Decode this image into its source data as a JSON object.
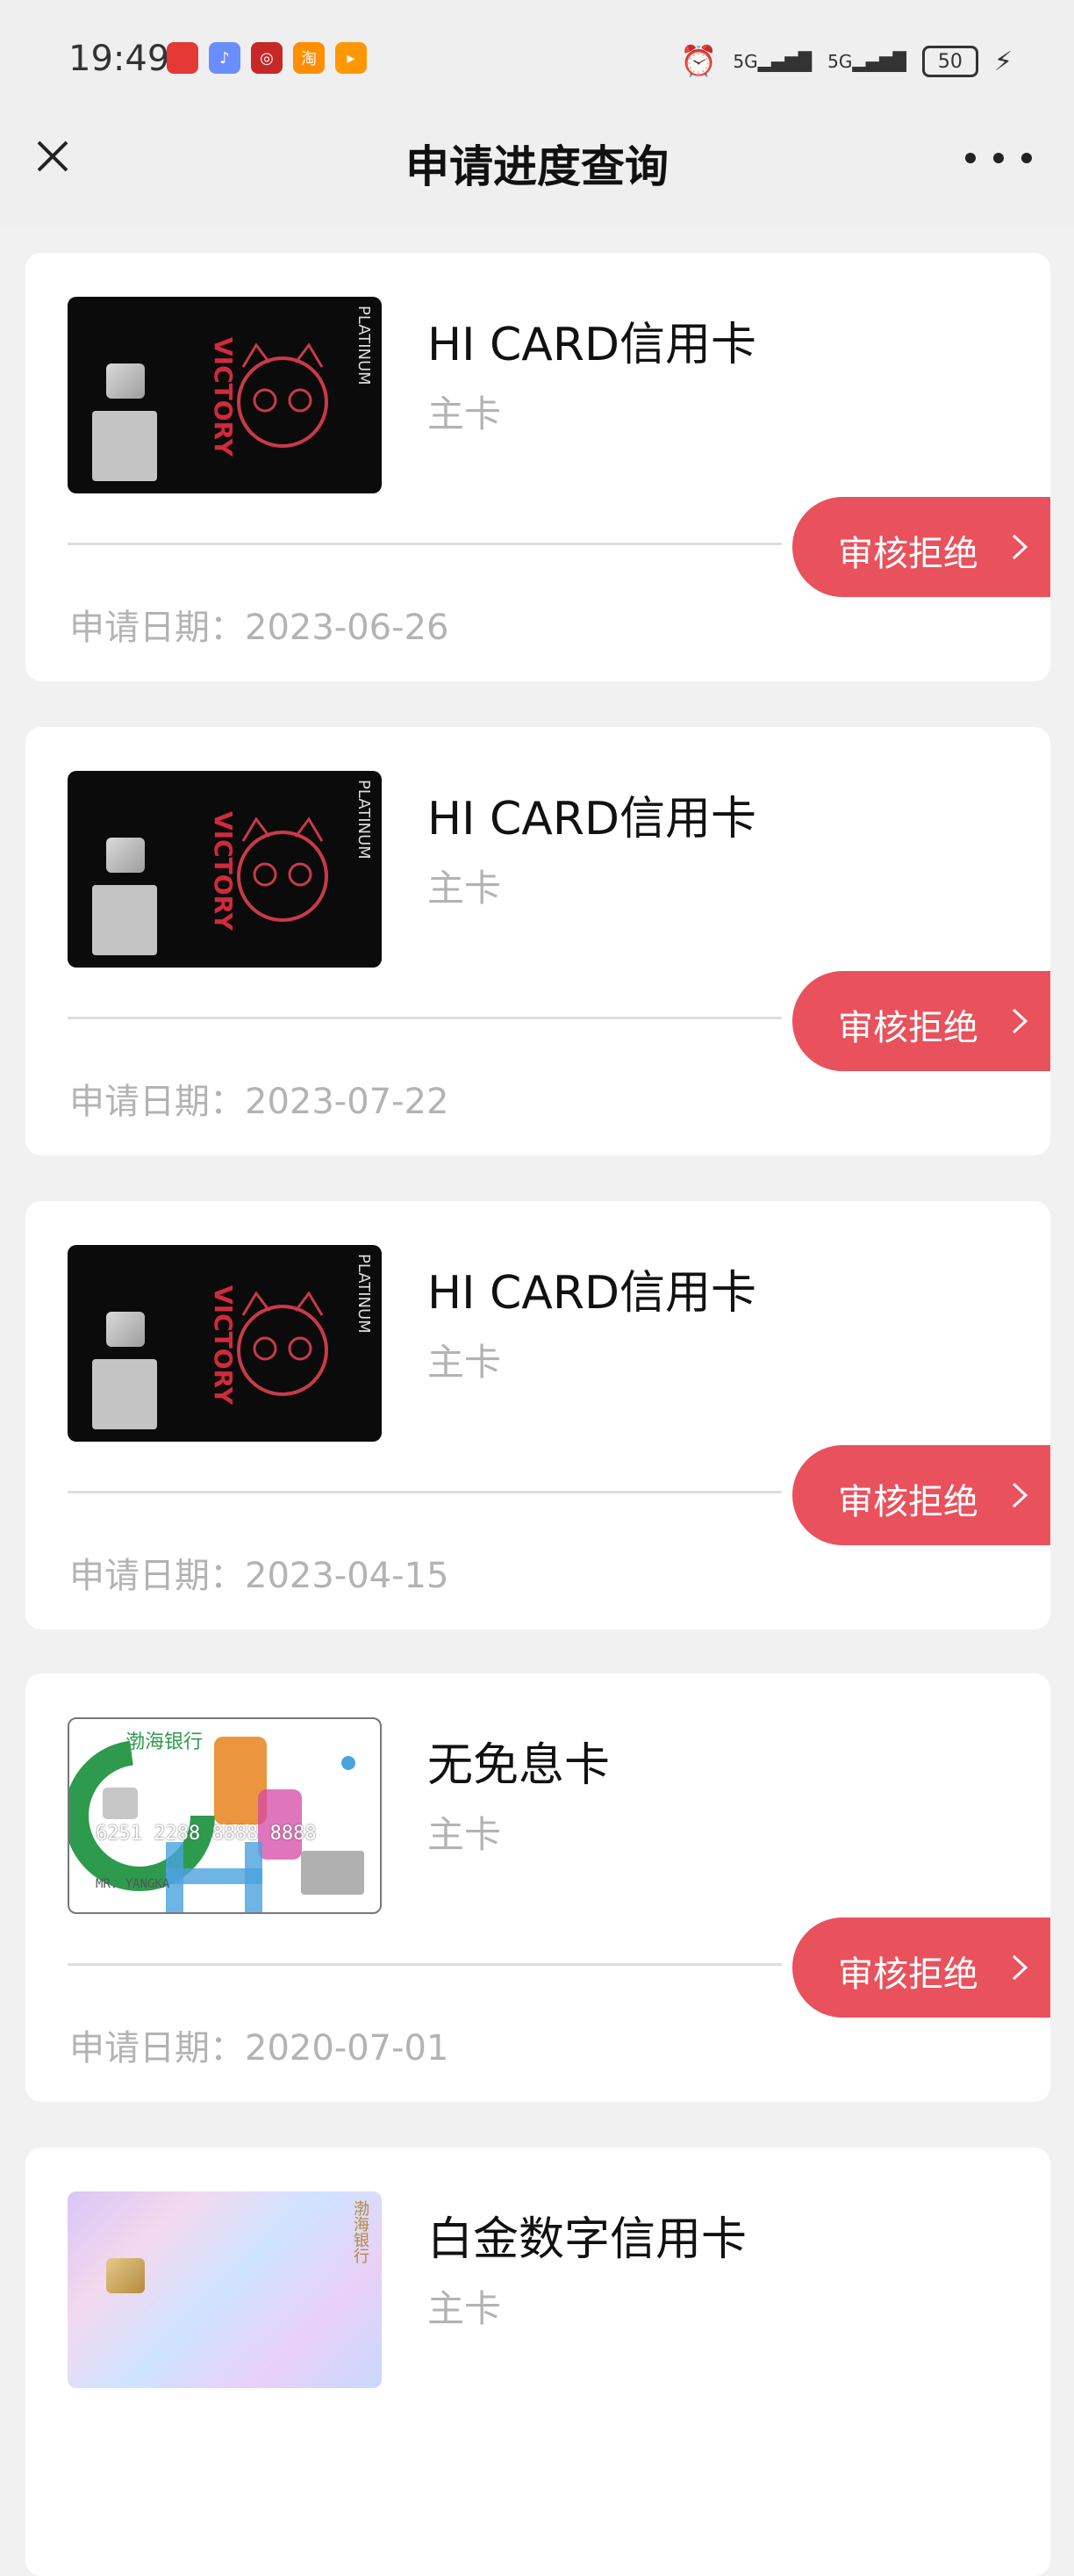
{
  "status_bar": {
    "time": "19:49",
    "battery": "50",
    "signal_1": "5G",
    "signal_2": "5G"
  },
  "header": {
    "title": "申请进度查询"
  },
  "applications": [
    {
      "card_name": "HI CARD信用卡",
      "card_type": "主卡",
      "status": "审核拒绝",
      "date_label": "申请日期：2023-06-26",
      "art": "black-victory-card",
      "art_text": "VICTORY",
      "art_badge": "PLATINUM"
    },
    {
      "card_name": "HI CARD信用卡",
      "card_type": "主卡",
      "status": "审核拒绝",
      "date_label": "申请日期：2023-07-22",
      "art": "black-victory-card",
      "art_text": "VICTORY",
      "art_badge": "PLATINUM"
    },
    {
      "card_name": "HI CARD信用卡",
      "card_type": "主卡",
      "status": "审核拒绝",
      "date_label": "申请日期：2023-04-15",
      "art": "black-victory-card",
      "art_text": "VICTORY",
      "art_badge": "PLATINUM"
    },
    {
      "card_name": "无免息卡",
      "card_type": "主卡",
      "status": "审核拒绝",
      "date_label": "申请日期：2020-07-01",
      "art": "white-chb-card",
      "art_text": "渤海银行",
      "art_number": "6251 2288 8888 8888",
      "art_holder": "MR. YANGKA"
    },
    {
      "card_name": "白金数字信用卡",
      "card_type": "主卡",
      "art": "holographic-card",
      "art_text": "渤海银行"
    }
  ],
  "colors": {
    "accent": "#e9515c",
    "bg": "#f1f1f1",
    "muted_text": "#b3b3b3"
  }
}
